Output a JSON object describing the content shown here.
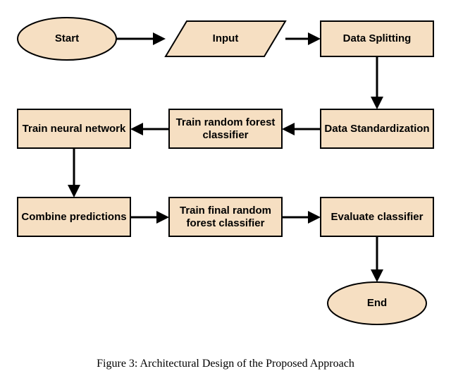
{
  "nodes": {
    "start": {
      "label": "Start"
    },
    "input": {
      "label": "Input"
    },
    "split": {
      "label": "Data Splitting"
    },
    "std": {
      "label": "Data Standardization"
    },
    "rf1": {
      "line1": "Train random forest",
      "line2": "classifier"
    },
    "nn": {
      "label": "Train neural network"
    },
    "combine": {
      "label": "Combine predictions"
    },
    "rf2": {
      "line1": "Train final random",
      "line2": "forest classifier"
    },
    "eval": {
      "label": "Evaluate classifier"
    },
    "end": {
      "label": "End"
    }
  },
  "caption_prefix": "Figure 3: Architectural Design of the Proposed Approach",
  "chart_data": {
    "type": "flowchart",
    "title": "Architectural Design of the Proposed Approach",
    "nodes": [
      {
        "id": "start",
        "shape": "terminator",
        "label": "Start"
      },
      {
        "id": "input",
        "shape": "parallelogram",
        "label": "Input"
      },
      {
        "id": "split",
        "shape": "process",
        "label": "Data Splitting"
      },
      {
        "id": "std",
        "shape": "process",
        "label": "Data Standardization"
      },
      {
        "id": "rf1",
        "shape": "process",
        "label": "Train random forest classifier"
      },
      {
        "id": "nn",
        "shape": "process",
        "label": "Train neural network"
      },
      {
        "id": "combine",
        "shape": "process",
        "label": "Combine predictions"
      },
      {
        "id": "rf2",
        "shape": "process",
        "label": "Train final random forest classifier"
      },
      {
        "id": "eval",
        "shape": "process",
        "label": "Evaluate classifier"
      },
      {
        "id": "end",
        "shape": "terminator",
        "label": "End"
      }
    ],
    "edges": [
      {
        "from": "start",
        "to": "input"
      },
      {
        "from": "input",
        "to": "split"
      },
      {
        "from": "split",
        "to": "std"
      },
      {
        "from": "std",
        "to": "rf1"
      },
      {
        "from": "rf1",
        "to": "nn"
      },
      {
        "from": "nn",
        "to": "combine"
      },
      {
        "from": "combine",
        "to": "rf2"
      },
      {
        "from": "rf2",
        "to": "eval"
      },
      {
        "from": "eval",
        "to": "end"
      }
    ]
  }
}
